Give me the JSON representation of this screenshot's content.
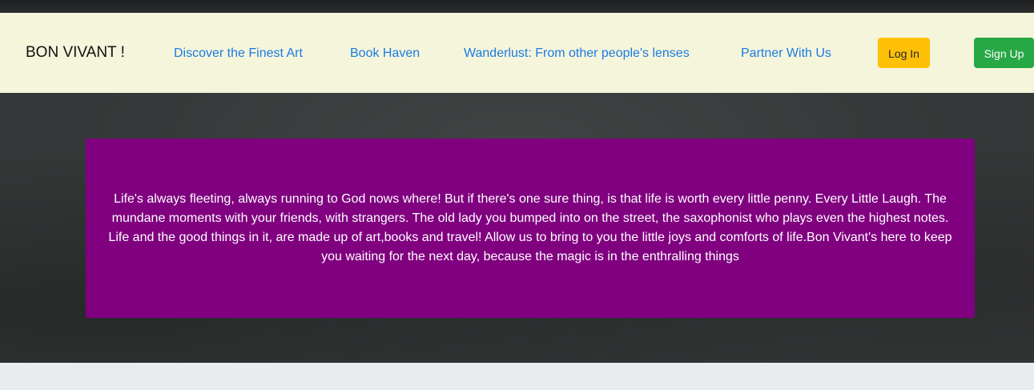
{
  "navbar": {
    "brand": "BON VIVANT !",
    "links": [
      "Discover the Finest Art",
      "Book Haven",
      "Wanderlust: From other people's lenses",
      "Partner With Us"
    ],
    "login_label": "Log In",
    "signup_label": "Sign Up"
  },
  "hero": {
    "text": "Life's always fleeting, always running to God nows where! But if there's one sure thing, is that life is worth every little penny. Every Little Laugh. The mundane moments with your friends, with strangers. The old lady you bumped into on the street, the saxophonist who plays even the highest notes. Life and the good things in it, are made up of art,books and travel! Allow us to bring to you the little joys and comforts of life.Bon Vivant's here to keep you waiting for the next day, because the magic is in the enthralling things"
  },
  "colors": {
    "navbar_bg": "#f5f5dc",
    "link": "#1b7be0",
    "login_button": "#ffc107",
    "signup_button": "#28a745",
    "hero_card": "#800080",
    "hero_bg": "#353838",
    "page_bg": "#e9ecef"
  }
}
